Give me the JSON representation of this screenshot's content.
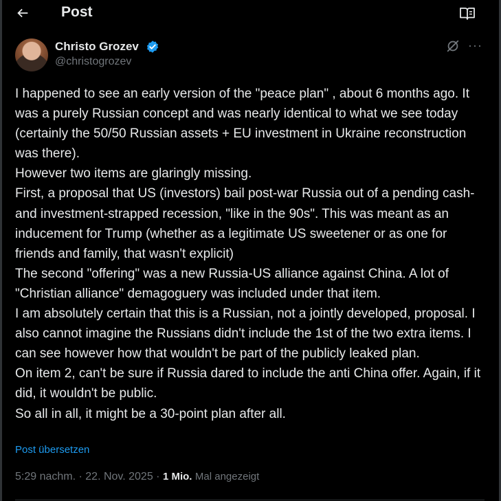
{
  "header": {
    "title": "Post",
    "back_icon": "arrow-left-icon",
    "reader_icon": "book-open-icon"
  },
  "author": {
    "name": "Christo Grozev",
    "handle": "@christogrozev",
    "verified_icon": "verified-badge-icon",
    "verified_color": "#1d9bf0"
  },
  "actions": {
    "grok_icon": "grok-icon",
    "more_label": "···"
  },
  "post": {
    "text": "I happened to see an early version of the \"peace plan\" , about 6 months ago. It was a purely Russian concept and was nearly identical to what we see today (certainly the 50/50 Russian assets + EU investment in Ukraine reconstruction was there).\nHowever two items are glaringly missing.\nFirst, a proposal that US (investors) bail post-war Russia out of a pending cash- and investment-strapped recession, \"like in the 90s\". This was meant as an inducement for Trump (whether as a legitimate US sweetener or as one for friends and family, that wasn't explicit)\nThe second \"offering\" was a new Russia-US alliance against China.  A lot of \"Christian alliance\" demagoguery was included under that item.\nI am absolutely certain that this is a Russian, not a jointly developed, proposal. I also cannot imagine the Russians didn't include the 1st of the two extra items. I can see however how that wouldn't be part of the publicly leaked plan.\nOn item 2, can't be sure if Russia dared to include the anti China offer. Again, if it did, it wouldn't be public.\nSo all in all, it might be a 30-point plan after all.",
    "translate_label": "Post übersetzen"
  },
  "meta": {
    "time": "5:29 nachm.",
    "separator": " · ",
    "date": "22. Nov. 2025",
    "views_count": "1 Mio.",
    "views_label": "Mal angezeigt"
  },
  "colors": {
    "background": "#000000",
    "text": "#e7e9ea",
    "muted": "#71767b",
    "accent": "#1d9bf0"
  }
}
